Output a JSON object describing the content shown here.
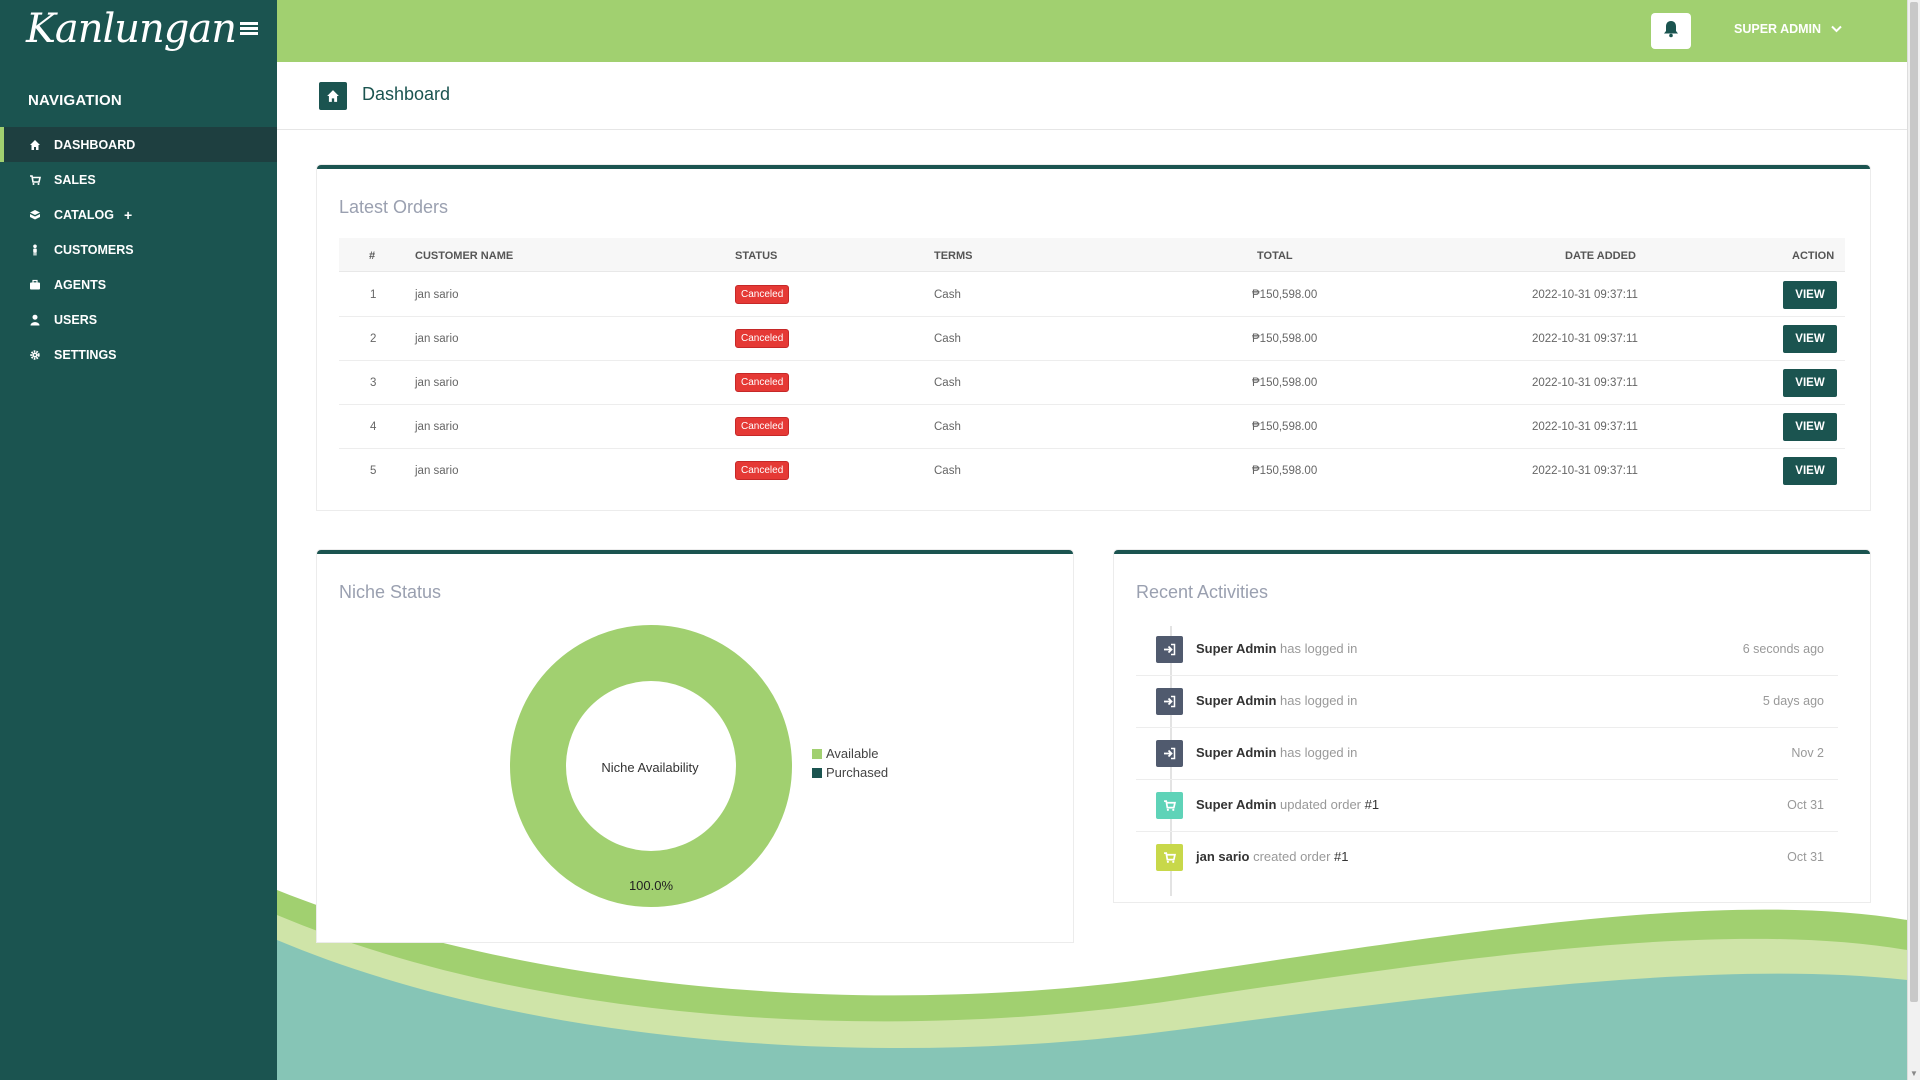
{
  "brand": {
    "logo": "Kanlungan"
  },
  "sidebar": {
    "heading": "NAVIGATION",
    "items": [
      {
        "label": "DASHBOARD",
        "icon": "home-icon"
      },
      {
        "label": "SALES",
        "icon": "cart-icon"
      },
      {
        "label": "CATALOG",
        "icon": "boxes-icon",
        "expand": "+"
      },
      {
        "label": "CUSTOMERS",
        "icon": "person-icon"
      },
      {
        "label": "AGENTS",
        "icon": "briefcase-icon"
      },
      {
        "label": "USERS",
        "icon": "user-icon"
      },
      {
        "label": "SETTINGS",
        "icon": "gear-icon"
      }
    ]
  },
  "topbar": {
    "user_label": "SUPER ADMIN"
  },
  "page": {
    "title": "Dashboard"
  },
  "orders": {
    "title": "Latest Orders",
    "headers": [
      "#",
      "CUSTOMER NAME",
      "STATUS",
      "TERMS",
      "TOTAL",
      "DATE ADDED",
      "ACTION"
    ],
    "rows": [
      {
        "num": "1",
        "customer": "jan sario",
        "status": "Canceled",
        "terms": "Cash",
        "total": "₱150,598.00",
        "date": "2022-10-31 09:37:11",
        "action": "VIEW"
      },
      {
        "num": "2",
        "customer": "jan sario",
        "status": "Canceled",
        "terms": "Cash",
        "total": "₱150,598.00",
        "date": "2022-10-31 09:37:11",
        "action": "VIEW"
      },
      {
        "num": "3",
        "customer": "jan sario",
        "status": "Canceled",
        "terms": "Cash",
        "total": "₱150,598.00",
        "date": "2022-10-31 09:37:11",
        "action": "VIEW"
      },
      {
        "num": "4",
        "customer": "jan sario",
        "status": "Canceled",
        "terms": "Cash",
        "total": "₱150,598.00",
        "date": "2022-10-31 09:37:11",
        "action": "VIEW"
      },
      {
        "num": "5",
        "customer": "jan sario",
        "status": "Canceled",
        "terms": "Cash",
        "total": "₱150,598.00",
        "date": "2022-10-31 09:37:11",
        "action": "VIEW"
      }
    ]
  },
  "niche": {
    "title": "Niche Status",
    "center_label": "Niche Availability",
    "slice_label": "100.0%",
    "legend": [
      "Available",
      "Purchased"
    ]
  },
  "activities": {
    "title": "Recent Activities",
    "items": [
      {
        "actor": "Super Admin",
        "verb": "has logged in",
        "ref": "",
        "time": "6 seconds ago",
        "icon": "login-icon",
        "color": "#505a6e"
      },
      {
        "actor": "Super Admin",
        "verb": "has logged in",
        "ref": "",
        "time": "5 days ago",
        "icon": "login-icon",
        "color": "#505a6e"
      },
      {
        "actor": "Super Admin",
        "verb": "has logged in",
        "ref": "",
        "time": "Nov 2",
        "icon": "login-icon",
        "color": "#505a6e"
      },
      {
        "actor": "Super Admin",
        "verb": "updated order",
        "ref": "#1",
        "time": "Oct 31",
        "icon": "cart-icon",
        "color": "#5fd3b8"
      },
      {
        "actor": "jan sario",
        "verb": "created order",
        "ref": "#1",
        "time": "Oct 31",
        "icon": "cart-icon",
        "color": "#c8d84a"
      }
    ]
  },
  "colors": {
    "sidebar": "#1b5450",
    "topbar": "#a1d070",
    "danger": "#e53935",
    "available": "#a1d070",
    "purchased": "#1b5450"
  },
  "chart_data": {
    "type": "pie",
    "title": "",
    "categories": [
      "Available",
      "Purchased"
    ],
    "values": [
      100.0,
      0.0
    ],
    "legend_position": "right"
  }
}
